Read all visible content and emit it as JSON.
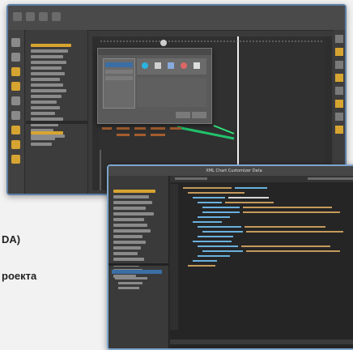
{
  "left_text": {
    "line1": "DA)",
    "line2": "роекта"
  },
  "front_window": {
    "title": "XML Chart Customizer Data"
  },
  "colors": {
    "accent_blue": "#5d7fa6",
    "selected_row": "#3a6ea5",
    "editor_bg": "#252525"
  }
}
